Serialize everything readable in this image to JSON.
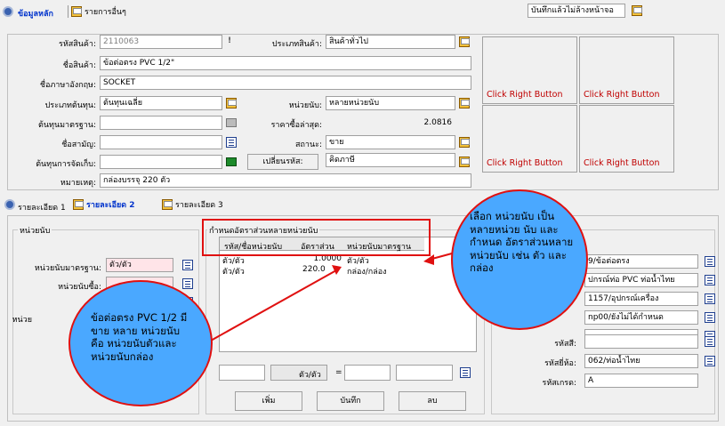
{
  "top_tabs": [
    {
      "label": "ข้อมูลหลัก",
      "active": true
    },
    {
      "label": "รายการอื่นๆ",
      "active": false
    }
  ],
  "top_right_field": "บันทึกแล้วไม่ล้างหน้าจอ",
  "form": {
    "code_label": "รหัสสินค้า:",
    "code_value": "2110063",
    "type_label": "ประเภทสินค้า:",
    "type_value": "สินค้าทั่วไป",
    "name_label": "ชื่อสินค้า:",
    "name_value": "ข้อต่อตรง PVC 1/2\"",
    "en_label": "ชื่อภาษาอังกฤษ:",
    "en_value": "SOCKET",
    "costtype_label": "ประเภทต้นทุน:",
    "costtype_value": "ต้นทุนเฉลี่ย",
    "unittype_label": "หน่วยนับ:",
    "unittype_value": "หลายหน่วยนับ",
    "stdcost_label": "ต้นทุนมาตรฐาน:",
    "stdcost_value": "",
    "lastprice_label": "ราคาซื้อล่าสุด:",
    "lastprice_value": "2.0816",
    "common_label": "ชื่อสามัญ:",
    "common_value": "",
    "status_label": "สถานะ:",
    "status_value": "ขาย",
    "storecost_label": "ต้นทุนการจัดเก็บ:",
    "storecost_value": "",
    "changecode_btn": "เปลี่ยนรหัส:",
    "changecode_value": "คิดภาษี",
    "note_label": "หมายเหตุ:",
    "note_value": "กล่องบรรจุ 220 ตัว"
  },
  "image_boxes": [
    "Click Right Button",
    "Click Right Button",
    "Click Right Button",
    "Click Right Button"
  ],
  "detail_tabs": [
    {
      "label": "รายละเอียด 1"
    },
    {
      "label": "รายละเอียด 2"
    },
    {
      "label": "รายละเอียด 3"
    }
  ],
  "unit_group": {
    "title": "หน่วยนับ",
    "std_label": "หน่วยนับมาตรฐาน:",
    "std_value": "ตัว/ตัว",
    "buy_label": "หน่วยนับซื้อ:",
    "sell_label_partial": "หน่วย"
  },
  "ratio_group": {
    "title": "กำหนดอัตราส่วนหลายหน่วยนับ",
    "columns": [
      "รหัส/ชื่อหน่วยนับ",
      "อัตราส่วน",
      "หน่วยนับมาตรฐาน"
    ],
    "rows": [
      [
        "ตัว/ตัว",
        "1.0000",
        "ตัว/ตัว"
      ],
      [
        "ตัว/ตัว",
        "220.0",
        "กล่อง/กล่อง"
      ]
    ],
    "eq_label": "ตัว/ตัว",
    "eq_sign": "=",
    "add_btn": "เพิ่ม",
    "save_btn": "บันทึก",
    "delete_btn": "ลบ"
  },
  "right_group": {
    "v1": "9/ข้อต่อตรง",
    "v2": "ปกรณ์ท่อ PVC ท่อน้ำไทย",
    "v3": "1157/อุปกรณ์เครื่อง",
    "v4": "np00/ยังไม่ได้กำหนด",
    "tax_label": "รหัสสี:",
    "tax_value": "",
    "brand_label": "รหัสยี่ห้อ:",
    "brand_value": "062/ท่อน้ำไทย",
    "grade_label": "รหัสเกรด:",
    "grade_value": "A"
  },
  "callout_right": "เลือก หน่วยนับ เป็น หลายหน่วย นับ และ กำหนด อัตราส่วนหลาย หน่วยนับ เช่น ตัว และ กล่อง",
  "callout_left": "ข้อต่อตรง PVC 1/2 มีขาย หลาย หน่วยนับ คือ หน่วยนับตัวและ หน่วยนับกล่อง",
  "colors": {
    "accent_blue": "#0033cc",
    "highlight_red": "#e01010",
    "callout_fill": "#4aa8ff",
    "callout_stroke": "#e01010",
    "pink": "#ffe4e8"
  }
}
